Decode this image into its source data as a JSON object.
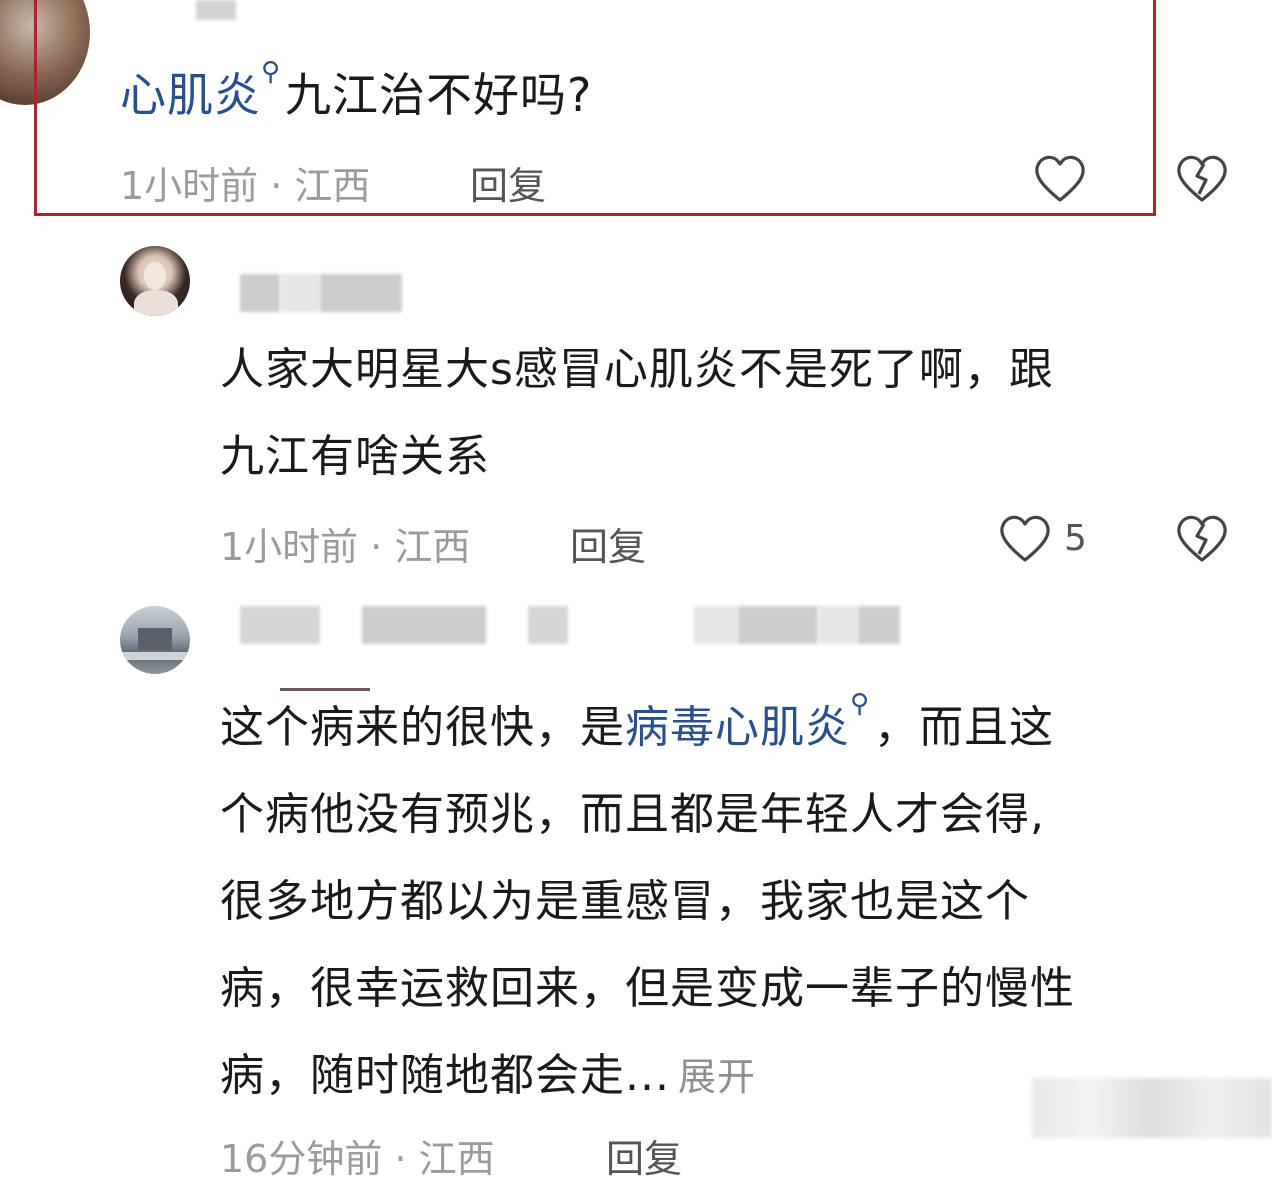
{
  "comment1": {
    "text_link": "心肌炎",
    "text_rest": "九江治不好吗?",
    "time": "1小时前 · 江西",
    "reply_label": "回复"
  },
  "comment2": {
    "line1": "人家大明星大s感冒心肌炎不是死了啊，跟",
    "line2": "九江有啥关系",
    "time": "1小时前 · 江西",
    "reply_label": "回复",
    "like_count": "5"
  },
  "comment3": {
    "line1_a": "这个病来的很快，是",
    "line1_link": "病毒心肌炎",
    "line1_b": "，而且这",
    "line2": "个病他没有预兆，而且都是年轻人才会得,",
    "line3": "很多地方都以为是重感冒，我家也是这个",
    "line4": "病，很幸运救回来，但是变成一辈子的慢性",
    "line5": "病，随时随地都会走...",
    "expand_label": "展开",
    "time_partial": "16分钟前 · 江西",
    "reply_partial": "回复"
  },
  "icons": {
    "like": "heart-outline-icon",
    "dislike": "broken-heart-icon",
    "search": "search-icon"
  },
  "colors": {
    "highlight_border": "#b0232a",
    "link": "#2a4f8e",
    "meta": "#9b9b9b"
  }
}
